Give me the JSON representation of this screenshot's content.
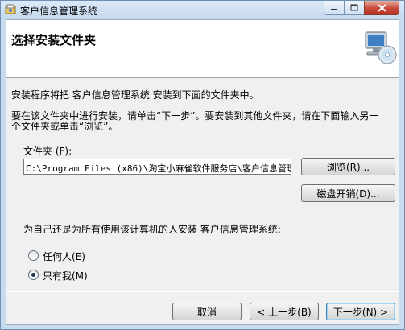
{
  "window": {
    "title": "客户信息管理系统"
  },
  "header": {
    "title": "选择安装文件夹"
  },
  "intro": {
    "line1": "安装程序将把 客户信息管理系统 安装到下面的文件夹中。",
    "line2a": "要在该文件夹中进行安装，请单击“下一步”。要安装到其他文件夹，请在下面输入另一",
    "line2b": "个文件夹或单击“浏览”。"
  },
  "folder": {
    "label": "文件夹 (F):",
    "value": "C:\\Program Files (x86)\\淘宝小麻雀软件服务店\\客户信息管理",
    "browse_label": "浏览(R)...",
    "disk_cost_label": "磁盘开销(D)..."
  },
  "users": {
    "question": "为自己还是为所有使用该计算机的人安装 客户信息管理系统:",
    "options": [
      {
        "label": "任何人(E)",
        "checked": false
      },
      {
        "label": "只有我(M)",
        "checked": true
      }
    ]
  },
  "footer": {
    "cancel_label": "取消",
    "back_label": "< 上一步(B)",
    "next_label": "下一步(N) >"
  }
}
